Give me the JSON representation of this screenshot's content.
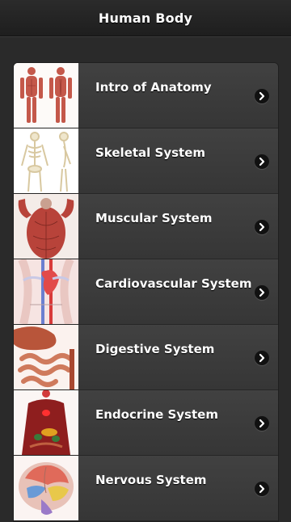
{
  "header": {
    "title": "Human Body"
  },
  "menu": {
    "items": [
      {
        "label": "Intro of Anatomy",
        "icon": "human-figure-front-back-icon"
      },
      {
        "label": "Skeletal System",
        "icon": "skeleton-icon"
      },
      {
        "label": "Muscular System",
        "icon": "muscles-back-icon"
      },
      {
        "label": "Cardiovascular System",
        "icon": "heart-vessels-icon"
      },
      {
        "label": "Digestive System",
        "icon": "intestines-icon"
      },
      {
        "label": "Endocrine System",
        "icon": "endocrine-torso-icon"
      },
      {
        "label": "Nervous System",
        "icon": "brain-icon"
      }
    ]
  },
  "colors": {
    "background": "#2a2a2a",
    "row": "#3b3b3b",
    "text": "#ffffff",
    "chevron_bg": "#111111"
  }
}
